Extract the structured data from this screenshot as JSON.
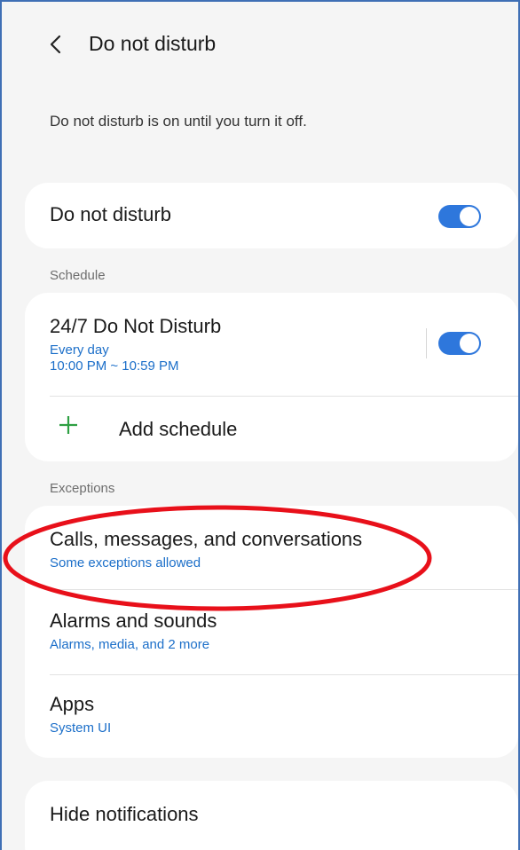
{
  "header": {
    "title": "Do not disturb",
    "back_icon": "chevron-left-icon"
  },
  "status": {
    "text": "Do not disturb is on until you turn it off."
  },
  "main_toggle": {
    "label": "Do not disturb",
    "on": true
  },
  "schedule": {
    "section_label": "Schedule",
    "item": {
      "title": "24/7 Do Not Disturb",
      "days": "Every day",
      "time": "10:00 PM ~ 10:59 PM",
      "on": true
    },
    "add_label": "Add schedule"
  },
  "exceptions": {
    "section_label": "Exceptions",
    "items": [
      {
        "title": "Calls, messages, and conversations",
        "subtitle": "Some exceptions allowed"
      },
      {
        "title": "Alarms and sounds",
        "subtitle": "Alarms, media, and 2 more"
      },
      {
        "title": "Apps",
        "subtitle": "System UI"
      }
    ]
  },
  "hide_notifications": {
    "label": "Hide notifications"
  },
  "colors": {
    "accent": "#2e77dc",
    "link": "#1c6fc9",
    "highlight": "#e8101a",
    "add_icon": "#2ea043"
  }
}
